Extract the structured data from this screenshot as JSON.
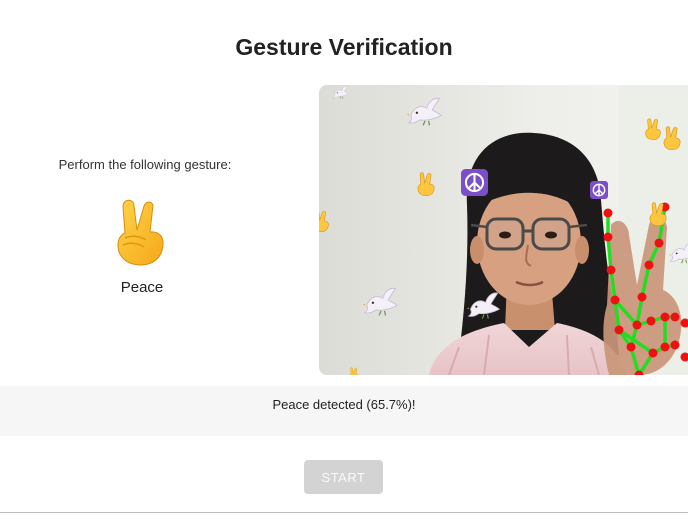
{
  "page": {
    "title": "Gesture Verification"
  },
  "instruction": {
    "prompt": "Perform the following gesture:",
    "gesture_icon": "victory-hand-emoji",
    "gesture_name": "Peace"
  },
  "camera": {
    "overlay_icons": [
      "dove-emoji",
      "victory-hand-emoji",
      "peace-symbol-emoji"
    ],
    "hand_landmark_color": "#ee1111",
    "hand_connection_color": "#22dd22"
  },
  "status": {
    "message": "Peace detected (65.7%)!"
  },
  "actions": {
    "start_label": "START",
    "start_color": "#d3d3d3"
  }
}
